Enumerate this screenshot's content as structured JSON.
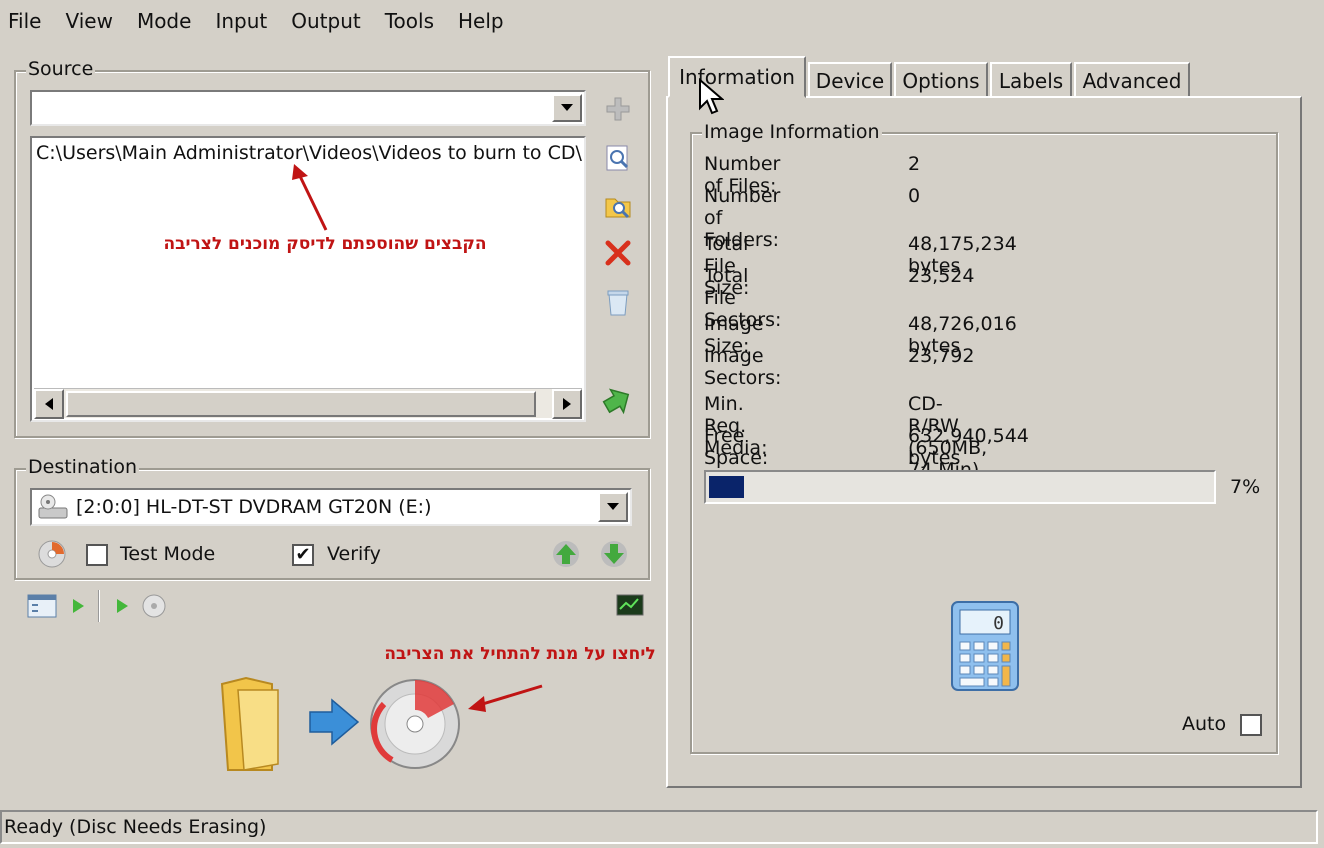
{
  "menu": [
    "File",
    "View",
    "Mode",
    "Input",
    "Output",
    "Tools",
    "Help"
  ],
  "source": {
    "legend": "Source",
    "combo_value": "",
    "list_items": [
      "C:\\Users\\Main Administrator\\Videos\\Videos to burn to CD\\"
    ],
    "annotation": "הקבצים שהוספתם לדיסק מוכנים לצריבה"
  },
  "destination": {
    "legend": "Destination",
    "drive": "[2:0:0] HL-DT-ST DVDRAM GT20N (E:)",
    "test_mode_label": "Test Mode",
    "test_mode_checked": false,
    "verify_label": "Verify",
    "verify_checked": true,
    "check_mark": "✔"
  },
  "burn_annotation": "ליחצו על מנת להתחיל את הצריבה",
  "tabs": [
    "Information",
    "Device",
    "Options",
    "Labels",
    "Advanced"
  ],
  "active_tab": "Information",
  "image_info": {
    "legend": "Image Information",
    "rows": [
      {
        "label": "Number of Files:",
        "value": "2"
      },
      {
        "label": "Number of Folders:",
        "value": "0"
      },
      {
        "label": "Total File Size:",
        "value": "48,175,234 bytes"
      },
      {
        "label": "Total File Sectors:",
        "value": "23,524"
      },
      {
        "label": "Image Size:",
        "value": "48,726,016 bytes"
      },
      {
        "label": "Image Sectors:",
        "value": "23,792"
      },
      {
        "label": "Min. Req. Media:",
        "value": "CD-R/RW (650MB, 74 Min)"
      },
      {
        "label": "Free Space:",
        "value": "632,940,544 bytes"
      }
    ],
    "progress_text": "7%",
    "progress_fraction": 0.07,
    "calculator_display": "0",
    "auto_label": "Auto",
    "auto_checked": false
  },
  "status": "Ready (Disc Needs Erasing)",
  "colors": {
    "window_bg": "#d4d0c8",
    "progress_fill": "#0a246a",
    "annotation_red": "#c01414"
  }
}
